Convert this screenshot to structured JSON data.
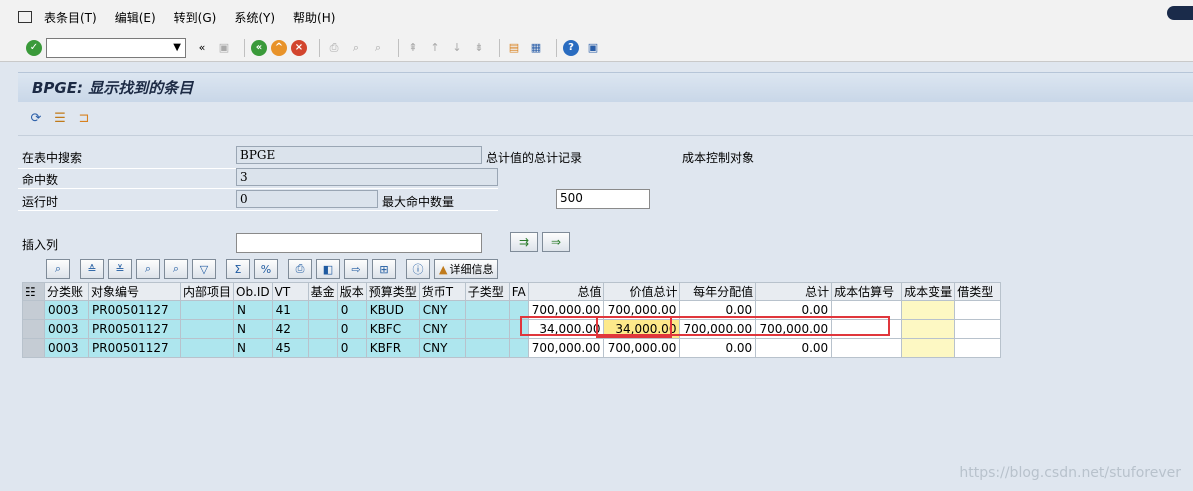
{
  "menu": {
    "items": [
      "表条目(T)",
      "编辑(E)",
      "转到(G)",
      "系统(Y)",
      "帮助(H)"
    ]
  },
  "title": "BPGE: 显示找到的条目",
  "form": {
    "search_label": "在表中搜索",
    "search_value": "BPGE",
    "total_label": "总计值的总计记录",
    "cost_label": "成本控制对象",
    "hits_label": "命中数",
    "hits_value": "3",
    "runtime_label": "运行时",
    "runtime_value": "0",
    "max_hits_label": "最大命中数量",
    "max_hits_value": "500",
    "insert_col_label": "插入列"
  },
  "alv": {
    "detail_button": "详细信息"
  },
  "table": {
    "headers": [
      "分类账",
      "对象编号",
      "内部项目",
      "Ob.ID",
      "VT",
      "基金",
      "版本",
      "预算类型",
      "货币T",
      "子类型",
      "FA",
      "总值",
      "价值总计",
      "每年分配值",
      "总计",
      "成本估算号",
      "成本变量",
      "借类型"
    ],
    "rows": [
      [
        "0003",
        "PR00501127",
        "",
        "N",
        "41",
        "",
        "0",
        "KBUD",
        "CNY",
        "",
        "",
        "700,000.00",
        "700,000.00",
        "0.00",
        "0.00",
        "",
        "",
        ""
      ],
      [
        "0003",
        "PR00501127",
        "",
        "N",
        "42",
        "",
        "0",
        "KBFC",
        "CNY",
        "",
        "",
        "34,000.00",
        "34,000.00",
        "700,000.00",
        "700,000.00",
        "",
        "",
        ""
      ],
      [
        "0003",
        "PR00501127",
        "",
        "N",
        "45",
        "",
        "0",
        "KBFR",
        "CNY",
        "",
        "",
        "700,000.00",
        "700,000.00",
        "0.00",
        "0.00",
        "",
        "",
        ""
      ]
    ]
  },
  "watermark": "https://blog.csdn.net/stuforever"
}
